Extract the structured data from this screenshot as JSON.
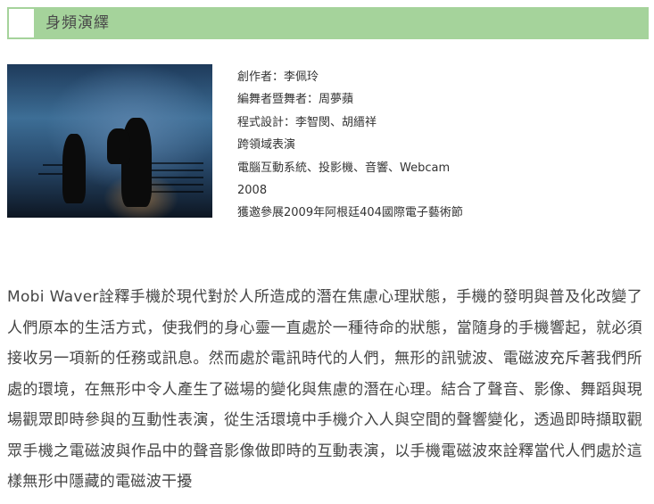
{
  "header": {
    "title": "身頻演繹"
  },
  "work": {
    "photo_alt": "performance-photo",
    "credits": [
      "創作者：李佩玲",
      "編舞者暨舞者：周夢蘋",
      "程式設計：李智閔、胡縉祥",
      "跨領域表演",
      "電腦互動系統、投影機、音響、Webcam",
      "2008",
      "獲邀參展2009年阿根廷404國際電子藝術節"
    ],
    "description": "Mobi Waver詮釋手機於現代對於人所造成的潛在焦慮心理狀態，手機的發明與普及化改變了人們原本的生活方式，使我們的身心靈一直處於一種待命的狀態，當隨身的手機響起，就必須接收另一項新的任務或訊息。然而處於電訊時代的人們，無形的訊號波、電磁波充斥著我們所處的環境，在無形中令人產生了磁場的變化與焦慮的潛在心理。結合了聲音、影像、舞蹈與現場觀眾即時參與的互動性表演，從生活環境中手機介入人與空間的聲響變化，透過即時擷取觀眾手機之電磁波與作品中的聲音影像做即時的互動表演，以手機電磁波來詮釋當代人們處於這樣無形中隱藏的電磁波干擾"
  },
  "colors": {
    "header_bg": "#a5d39b",
    "text": "#333333"
  }
}
